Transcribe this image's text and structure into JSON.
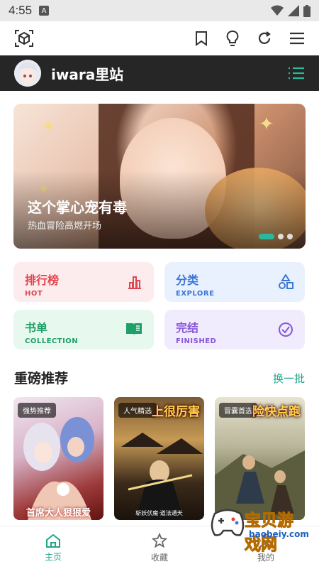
{
  "status_bar": {
    "time": "4:55",
    "notif_letter": "A"
  },
  "header": {
    "site_title": "iwara里站"
  },
  "banner": {
    "title": "这个掌心宠有毒",
    "subtitle": "热血冒险高燃开场",
    "pages": 3,
    "current_page": 1
  },
  "categories": [
    {
      "title": "排行榜",
      "subtitle": "HOT",
      "icon": "bar-chart-icon",
      "bg": "#fdeced",
      "fg": "#e0454f"
    },
    {
      "title": "分类",
      "subtitle": "EXPLORE",
      "icon": "shapes-icon",
      "bg": "#e9f1fe",
      "fg": "#3c77d6"
    },
    {
      "title": "书单",
      "subtitle": "COLLECTION",
      "icon": "book-icon",
      "bg": "#e7f8ef",
      "fg": "#1fa068"
    },
    {
      "title": "完结",
      "subtitle": "FINISHED",
      "icon": "check-circle-icon",
      "bg": "#f1ecfd",
      "fg": "#8657d9"
    }
  ],
  "recommend": {
    "title": "重磅推荐",
    "more": "换一批",
    "items": [
      {
        "tag": "强势推荐",
        "title": "首席大人狠狠爱",
        "cover": "anime-couple"
      },
      {
        "tag": "人气精选",
        "headline": "上很厉害",
        "subtitle": "斩妖伏魔·道法通天",
        "cover": "swordsman"
      },
      {
        "tag": "冒囊首选",
        "headline": "险快点跑",
        "cover": "running-warriors"
      }
    ]
  },
  "bottom_nav": [
    {
      "label": "主页",
      "icon": "home-icon",
      "active": true
    },
    {
      "label": "收藏",
      "icon": "star-icon",
      "active": false
    },
    {
      "label": "我的",
      "icon": "user-icon",
      "active": false
    }
  ],
  "watermark": {
    "text": "宝贝游戏网",
    "url": "baobeiy.com"
  },
  "colors": {
    "accent": "#1fa68a",
    "header_bg": "#262626"
  }
}
